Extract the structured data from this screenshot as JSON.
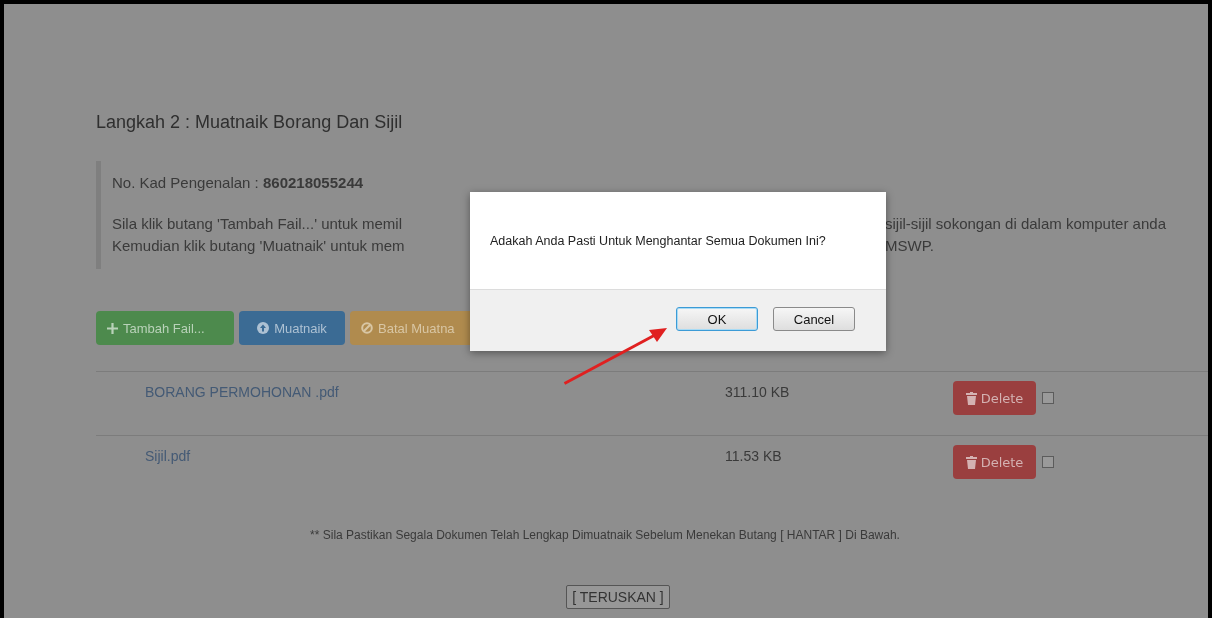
{
  "page": {
    "heading": "Langkah 2 : Muatnaik Borang Dan Sijil",
    "id_line": "No. Kad Pengenalan : **860218055244**",
    "instruction_lines": [
      {
        "left": "Sila klik butang 'Tambah Fail...' untuk memil",
        "right": "sijil-sijil sokongan di dalam komputer anda"
      },
      {
        "left": "Kemudian klik butang 'Muatnaik' untuk mem",
        "right": "MSWP."
      }
    ]
  },
  "actions": [
    {
      "kind": "add",
      "label": "Tambah Fail..."
    },
    {
      "kind": "upload",
      "label": "Muatnaik"
    },
    {
      "kind": "cancel",
      "label": "Batal Muatna"
    }
  ],
  "files": [
    {
      "name": "BORANG PERMOHONAN .pdf",
      "size": "311.10 KB",
      "action": "Delete",
      "checked": false
    },
    {
      "name": "Sijil.pdf",
      "size": "11.53 KB",
      "action": "Delete",
      "checked": false
    }
  ],
  "note": "** Sila Pastikan Segala Dokumen Telah Lengkap Dimuatnaik Sebelum Menekan Butang [ HANTAR ] Di Bawah.",
  "continue_button": "[ TERUSKAN ]",
  "dialog": {
    "message": "Adakah Anda Pasti Untuk Menghantar Semua Dokumen Ini?",
    "buttons": [
      {
        "label": "OK",
        "selected": true
      },
      {
        "label": "Cancel",
        "selected": false
      }
    ]
  }
}
